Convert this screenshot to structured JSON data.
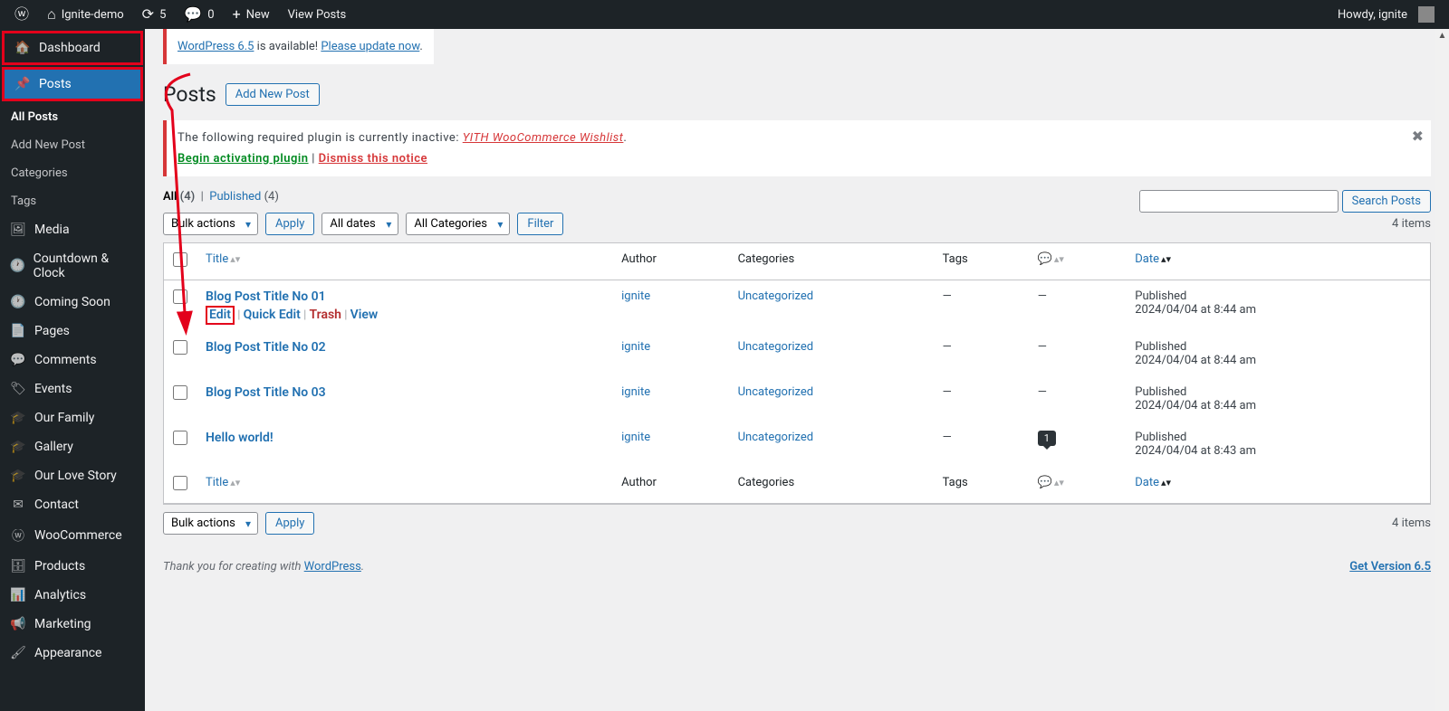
{
  "topbar": {
    "site_name": "Ignite-demo",
    "updates_count": "5",
    "comments_count": "0",
    "new_label": "New",
    "view_posts": "View Posts",
    "howdy": "Howdy, ignite"
  },
  "sidebar": {
    "dashboard": "Dashboard",
    "posts": "Posts",
    "all_posts": "All Posts",
    "add_new_post": "Add New Post",
    "categories": "Categories",
    "tags": "Tags",
    "media": "Media",
    "countdown": "Countdown & Clock",
    "coming_soon": "Coming Soon",
    "pages": "Pages",
    "comments": "Comments",
    "events": "Events",
    "our_family": "Our Family",
    "gallery": "Gallery",
    "our_love_story": "Our Love Story",
    "contact": "Contact",
    "woocommerce": "WooCommerce",
    "products": "Products",
    "analytics": "Analytics",
    "marketing": "Marketing",
    "appearance": "Appearance"
  },
  "update_nag": {
    "prefix": "WordPress 6.5",
    "mid": " is available! ",
    "link": "Please update now"
  },
  "page": {
    "title": "Posts",
    "add_new_btn": "Add New Post"
  },
  "notice": {
    "text_prefix": "The following required plugin is currently inactive: ",
    "plugin": "YITH WooCommerce Wishlist",
    "begin": "Begin activating plugin",
    "dismiss": "Dismiss this notice"
  },
  "filters": {
    "all": "All",
    "all_count": "(4)",
    "published": "Published",
    "published_count": "(4)",
    "bulk_actions": "Bulk actions",
    "apply": "Apply",
    "all_dates": "All dates",
    "all_categories": "All Categories",
    "filter": "Filter",
    "search_btn": "Search Posts",
    "items_count": "4 items"
  },
  "table": {
    "cols": {
      "title": "Title",
      "author": "Author",
      "categories": "Categories",
      "tags": "Tags",
      "date": "Date"
    },
    "row_actions": {
      "edit": "Edit",
      "quick_edit": "Quick Edit",
      "trash": "Trash",
      "view": "View"
    },
    "rows": [
      {
        "title": "Blog Post Title No 01",
        "author": "ignite",
        "category": "Uncategorized",
        "tags": "—",
        "comments": "—",
        "status": "Published",
        "date": "2024/04/04 at 8:44 am",
        "show_actions": true
      },
      {
        "title": "Blog Post Title No 02",
        "author": "ignite",
        "category": "Uncategorized",
        "tags": "—",
        "comments": "—",
        "status": "Published",
        "date": "2024/04/04 at 8:44 am",
        "show_actions": false
      },
      {
        "title": "Blog Post Title No 03",
        "author": "ignite",
        "category": "Uncategorized",
        "tags": "—",
        "comments": "—",
        "status": "Published",
        "date": "2024/04/04 at 8:44 am",
        "show_actions": false
      },
      {
        "title": "Hello world!",
        "author": "ignite",
        "category": "Uncategorized",
        "tags": "—",
        "comments": "1",
        "status": "Published",
        "date": "2024/04/04 at 8:43 am",
        "show_actions": false,
        "has_comment_bubble": true
      }
    ]
  },
  "footer": {
    "thanks": "Thank you for creating with ",
    "wp": "WordPress",
    "version": "Get Version 6.5"
  }
}
